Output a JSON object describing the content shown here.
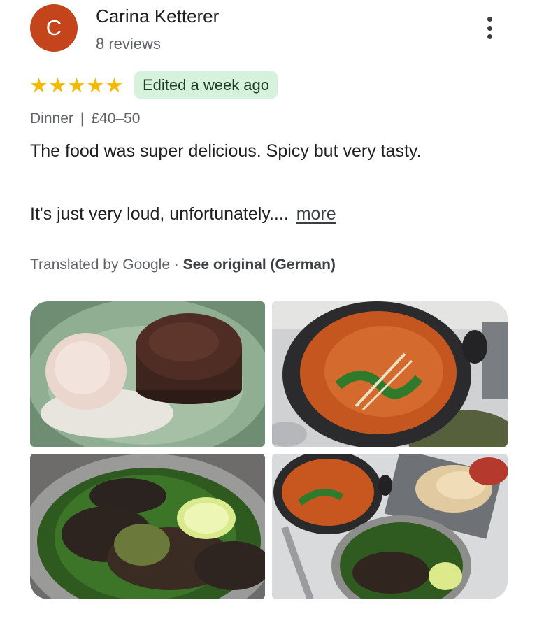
{
  "review": {
    "author_initial": "C",
    "author_name": "Carina Ketterer",
    "review_count": "8 reviews",
    "rating": 5,
    "stars": [
      "★",
      "★",
      "★",
      "★",
      "★"
    ],
    "edited_badge": "Edited a week ago",
    "meal_type": "Dinner",
    "separator": "|",
    "price_range": "£40–50",
    "text_line1": "The food was super delicious. Spicy but very tasty.",
    "text_line2": "It's just very loud, unfortunately....",
    "more_label": "more",
    "translated_prefix": "Translated by Google · ",
    "see_original_label": "See original (German)"
  },
  "colors": {
    "avatar_bg": "#c4451c",
    "star": "#f5b800",
    "badge_bg": "#d6f2dd"
  },
  "icons": {
    "menu": "more-vert-icon",
    "star": "star-icon"
  },
  "photos": [
    "dessert-photo",
    "curry-photo",
    "grilled-dish-photo",
    "table-spread-photo"
  ]
}
